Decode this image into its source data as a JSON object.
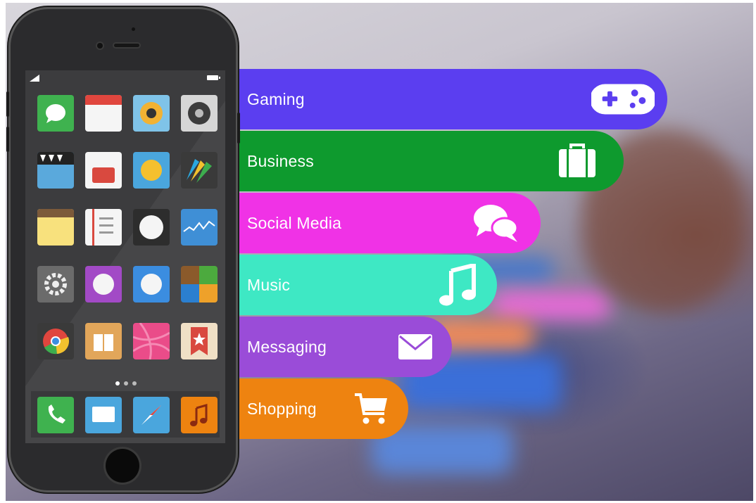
{
  "categories": [
    {
      "label": "Gaming",
      "color": "#5b3ef0",
      "icon": "gamepad-icon"
    },
    {
      "label": "Business",
      "color": "#0e9a2e",
      "icon": "briefcase-icon"
    },
    {
      "label": "Social Media",
      "color": "#f032e6",
      "icon": "chat-bubbles-icon"
    },
    {
      "label": "Music",
      "color": "#3ee8c4",
      "icon": "music-note-icon"
    },
    {
      "label": "Messaging",
      "color": "#9a4cd8",
      "icon": "envelope-icon"
    },
    {
      "label": "Shopping",
      "color": "#ee8310",
      "icon": "shopping-cart-icon"
    }
  ],
  "phone": {
    "apps": [
      "messages-app-icon",
      "calendar-app-icon",
      "camera-app-icon",
      "music-speaker-app-icon",
      "video-app-icon",
      "photos-app-icon",
      "weather-app-icon",
      "passbook-app-icon",
      "notes-app-icon",
      "reminders-app-icon",
      "clock-app-icon",
      "stocks-app-icon",
      "settings-app-icon",
      "game-center-app-icon",
      "itunes-app-icon",
      "newsstand-app-icon",
      "chrome-app-icon",
      "ibooks-app-icon",
      "dribbble-app-icon",
      "bookmark-app-icon"
    ],
    "dock": [
      "phone-app-icon",
      "mail-app-icon",
      "safari-app-icon",
      "music-app-icon"
    ]
  }
}
